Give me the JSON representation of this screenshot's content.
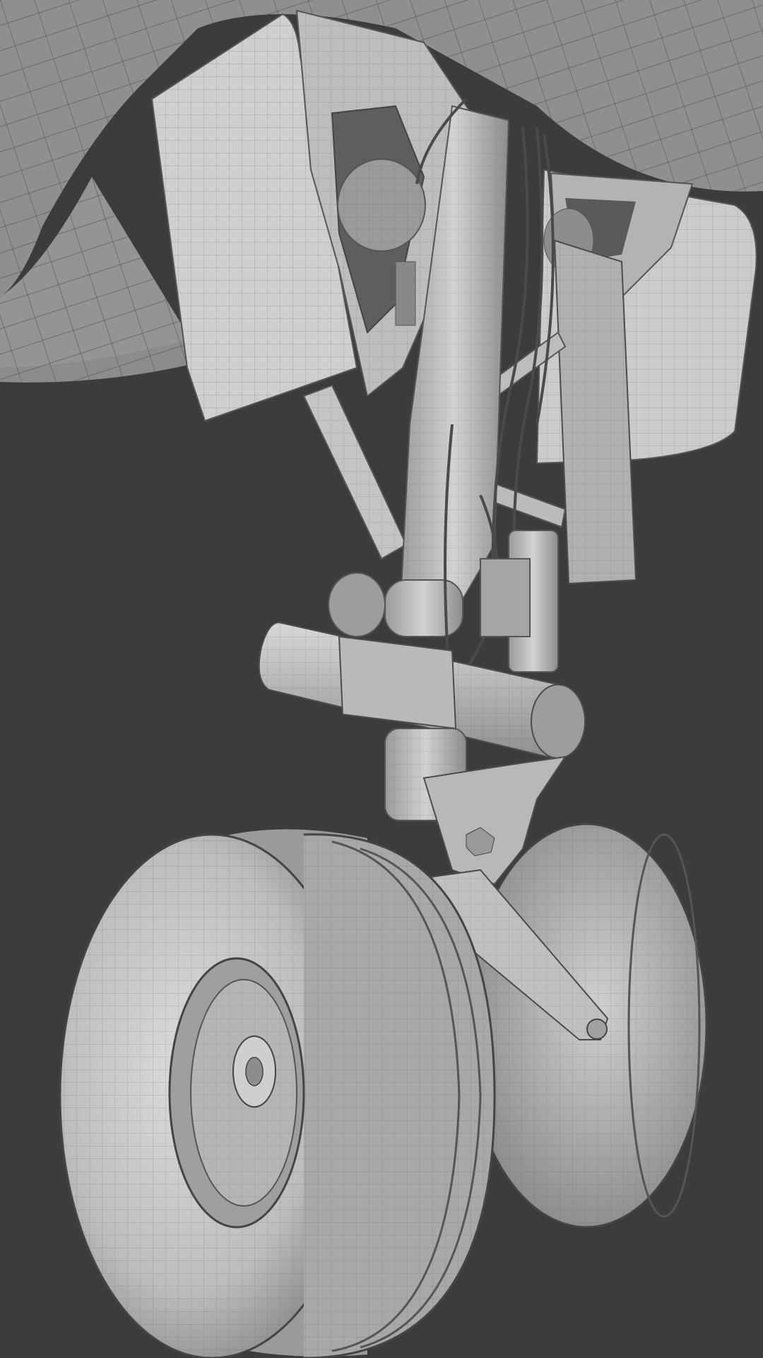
{
  "scene": {
    "subject": "landing-gear-wireframe-render",
    "colors": {
      "background": "#3c3c3c",
      "fuselage": "#8d8f91",
      "surface_light": "#d6d6d6",
      "surface_mid": "#b5b5b5",
      "surface_dark": "#8a8a8a",
      "wire": "#555555"
    }
  }
}
